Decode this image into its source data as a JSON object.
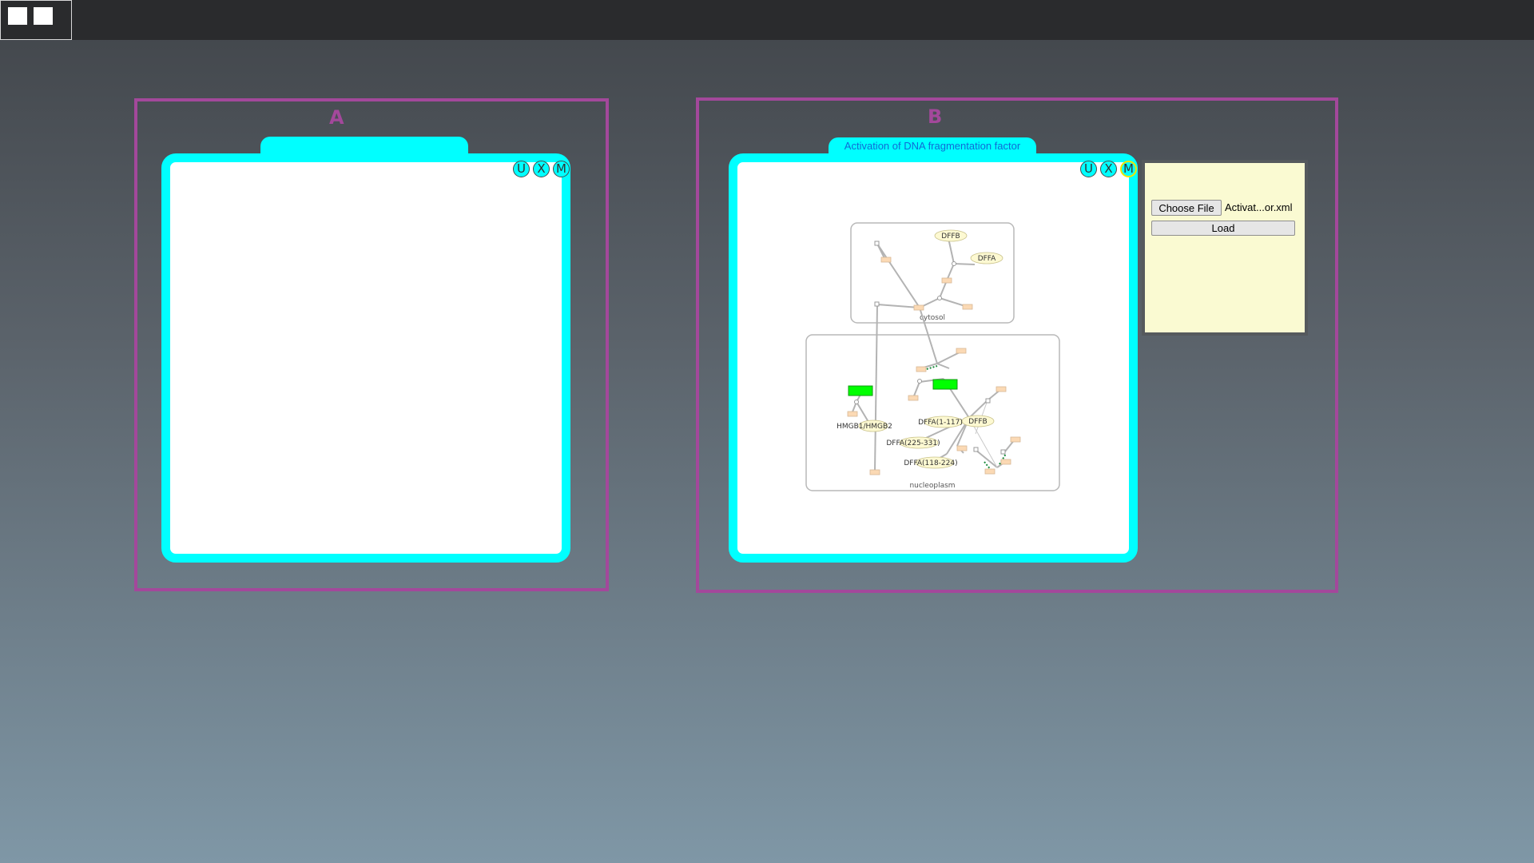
{
  "panels": {
    "a": {
      "letter": "A",
      "tab_title": ""
    },
    "b": {
      "letter": "B",
      "tab_title": "Activation of DNA fragmentation factor"
    }
  },
  "controls": [
    "U",
    "X",
    "M"
  ],
  "file_loader": {
    "choose_label": "Choose File",
    "file_name": "Activat...or.xml",
    "load_label": "Load"
  },
  "diagram": {
    "compartments": [
      "cytosol",
      "nucleoplasm"
    ],
    "labels": {
      "dffb_cytosol": "DFFB",
      "dffa_cytosol": "DFFA",
      "hmgb": "HMGB1/HMGB2",
      "dffa_1_117": "DFFA(1-117)",
      "dffb_nucleus": "DFFB",
      "dffa_225_331": "DFFA(225-331)",
      "dffa_118_224": "DFFA(118-224)"
    }
  },
  "colors": {
    "panel_border": "#a3489b",
    "viewer_border": "#00ffff",
    "tab_text": "#0f6bd6",
    "highlight_node": "#00ff00",
    "reaction_node": "#fbd9b4",
    "entity_node": "#fdf9d2",
    "file_panel_bg": "#fafad2"
  }
}
